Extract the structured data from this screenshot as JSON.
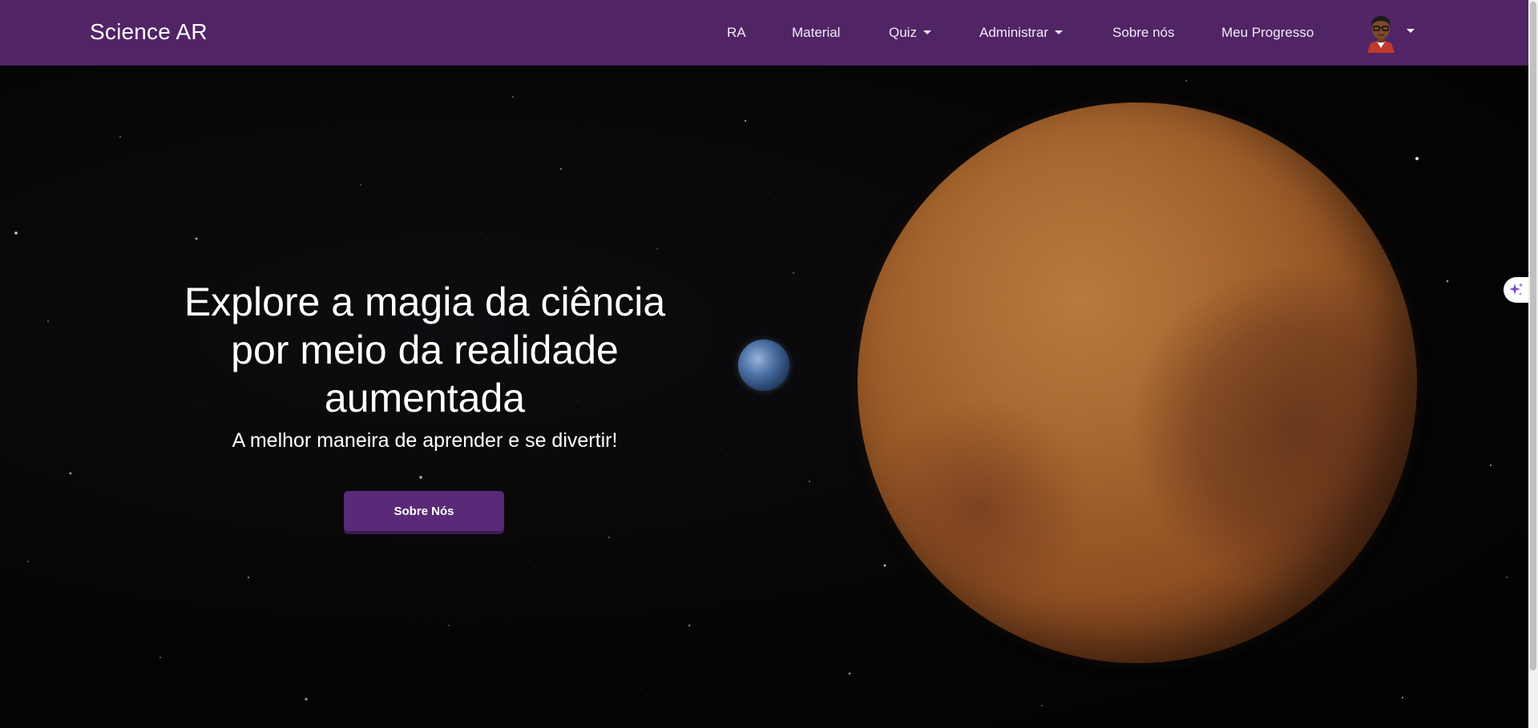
{
  "navbar": {
    "brand": "Science AR",
    "links": {
      "ra": "RA",
      "material": "Material",
      "quiz": "Quiz",
      "administrar": "Administrar",
      "sobre": "Sobre nós",
      "progresso": "Meu Progresso"
    },
    "background_color": "#512466"
  },
  "hero": {
    "title_line1": "Explore a magia da ciência",
    "title_line2": "por meio da realidade",
    "title_line3": "aumentada",
    "subtitle": "A melhor maneira de aprender e se divertir!",
    "button_label": "Sobre Nós",
    "button_color": "#5a2a78"
  },
  "icons": {
    "avatar": "user-avatar-icon",
    "sparkle": "sparkle-icon",
    "dropdown": "chevron-down-icon"
  }
}
